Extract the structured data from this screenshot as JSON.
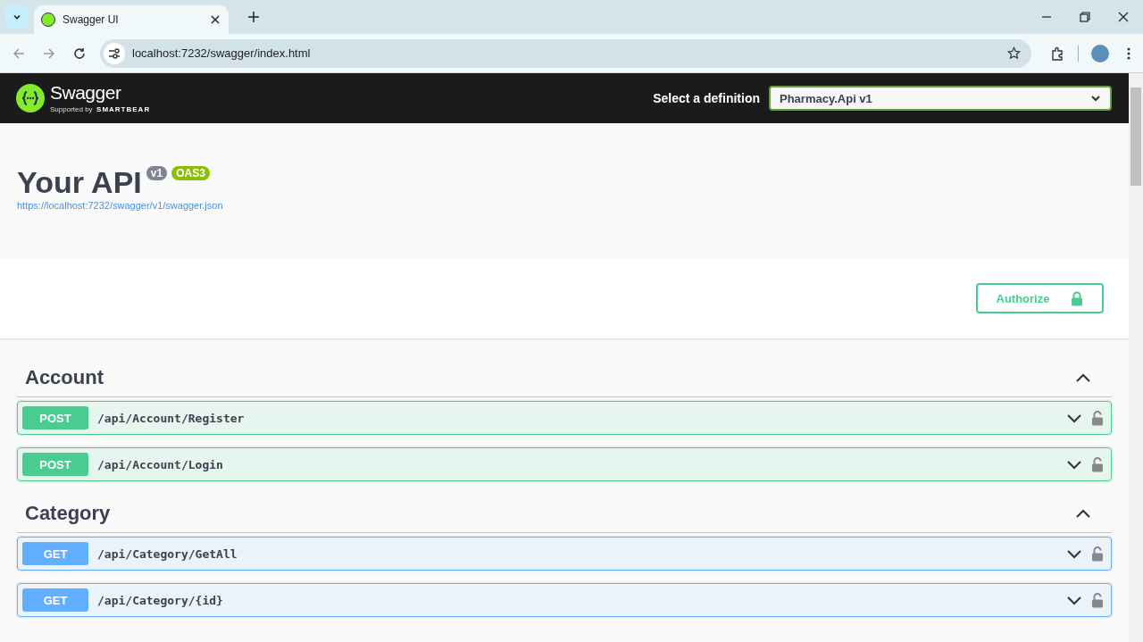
{
  "browser": {
    "tab_title": "Swagger UI",
    "address": "localhost:7232/swagger/index.html"
  },
  "topbar": {
    "brand": "Swagger",
    "brand_sub": "Supported by",
    "brand_company": "SMARTBEAR",
    "definition_label": "Select a definition",
    "definition_value": "Pharmacy.Api v1"
  },
  "info": {
    "title": "Your API",
    "version_badge": "v1",
    "oas_badge": "OAS3",
    "spec_link": "https://localhost:7232/swagger/v1/swagger.json"
  },
  "authorize_button": "Authorize",
  "sections": [
    {
      "name": "Account",
      "expanded": true,
      "operations": [
        {
          "method": "POST",
          "kind": "post",
          "path": "/api/Account/Register",
          "expanded": false
        },
        {
          "method": "POST",
          "kind": "post",
          "path": "/api/Account/Login",
          "expanded": false
        }
      ]
    },
    {
      "name": "Category",
      "expanded": true,
      "operations": [
        {
          "method": "GET",
          "kind": "get",
          "path": "/api/Category/GetAll",
          "expanded": false
        },
        {
          "method": "GET",
          "kind": "get",
          "path": "/api/Category/{id}",
          "expanded": false
        }
      ]
    }
  ]
}
